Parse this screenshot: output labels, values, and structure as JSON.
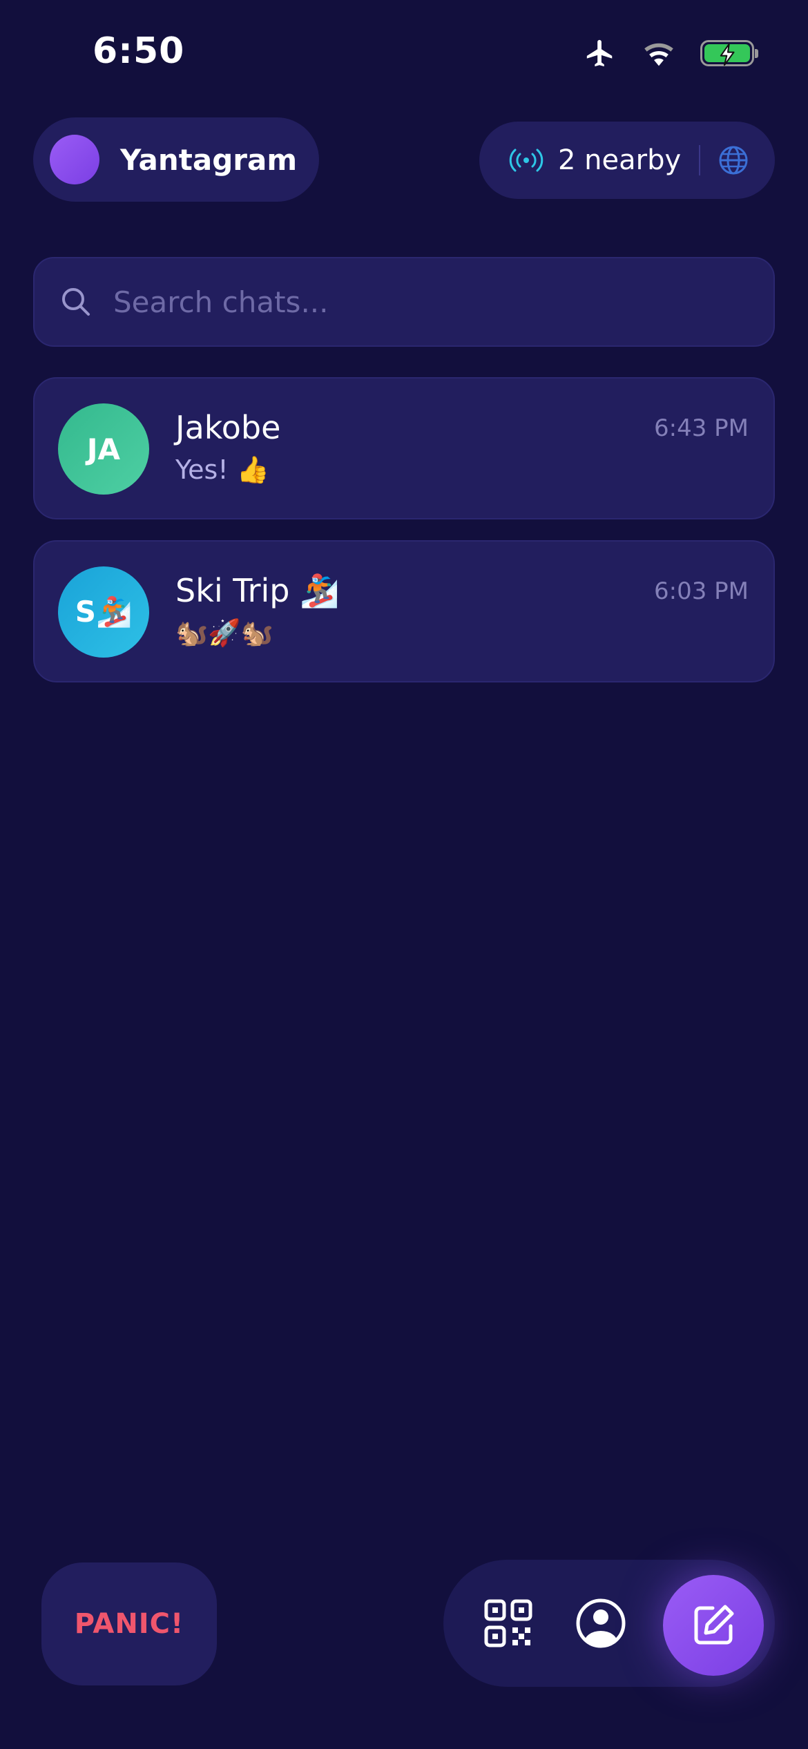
{
  "status_bar": {
    "time": "6:50",
    "icons": [
      "airplane-icon",
      "wifi-icon",
      "battery-charging-icon"
    ]
  },
  "header": {
    "profile_name": "Yantagram",
    "nearby_label": "2 nearby"
  },
  "search": {
    "placeholder": "Search chats..."
  },
  "chats": [
    {
      "initials": "JA",
      "name": "Jakobe",
      "preview": "Yes! 👍",
      "time": "6:43 PM",
      "avatar_color": "#3ec39a"
    },
    {
      "initials": "S🏂",
      "name": "Ski Trip 🏂",
      "preview": "🐿️🚀🐿️",
      "time": "6:03 PM",
      "avatar_color": "#22aede"
    }
  ],
  "bottom": {
    "panic_label": "PANIC!"
  },
  "colors": {
    "background": "#120f3d",
    "surface": "#221e5e",
    "accent": "#8b4cf0",
    "panic": "#f0566d",
    "signal": "#2ec7e6",
    "globe": "#3b6fd6"
  }
}
